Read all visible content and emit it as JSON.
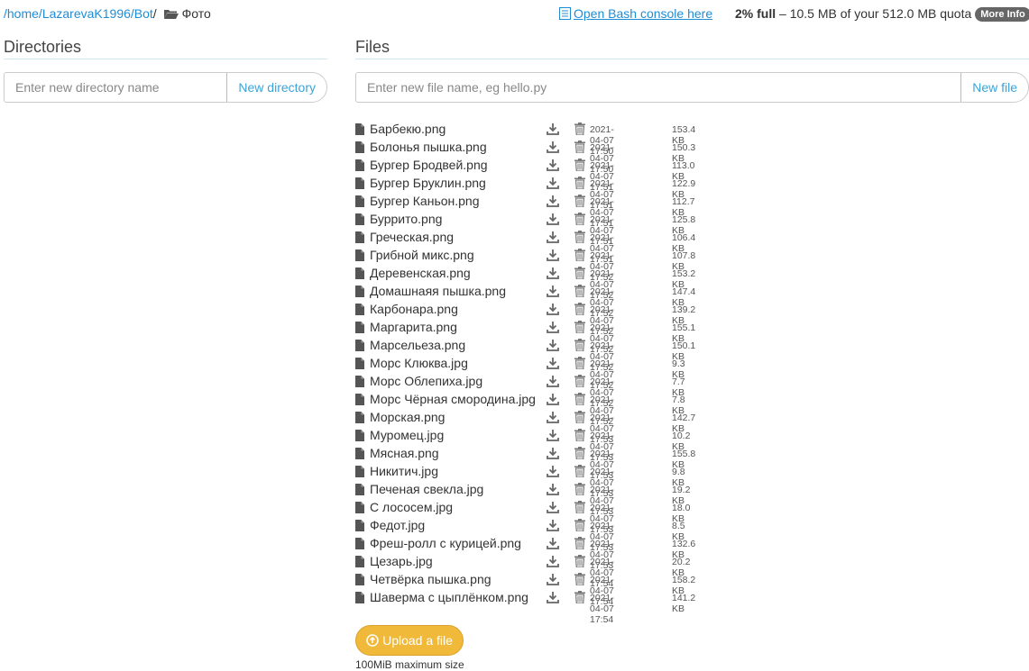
{
  "breadcrumb": {
    "segments": [
      "home",
      "LazarevaK1996",
      "Bot"
    ],
    "current": "Фото"
  },
  "header": {
    "bash_link": "Open Bash console here",
    "quota_percent": "2% full",
    "quota_text": " – 10.5 MB of your 512.0 MB quota",
    "more_info": "More Info"
  },
  "directories": {
    "title": "Directories",
    "placeholder": "Enter new directory name",
    "button": "New directory"
  },
  "files": {
    "title": "Files",
    "placeholder": "Enter new file name, eg hello.py",
    "button": "New file",
    "items": [
      {
        "name": "Барбекю.png",
        "date": "2021-04-07 17:50",
        "size": "153.4 KB"
      },
      {
        "name": "Болонья пышка.png",
        "date": "2021-04-07 17:50",
        "size": "150.3 KB"
      },
      {
        "name": "Бургер Бродвей.png",
        "date": "2021-04-07 17:51",
        "size": "113.0 KB"
      },
      {
        "name": "Бургер Бруклин.png",
        "date": "2021-04-07 17:51",
        "size": "122.9 KB"
      },
      {
        "name": "Бургер Каньон.png",
        "date": "2021-04-07 17:51",
        "size": "112.7 KB"
      },
      {
        "name": "Буррито.png",
        "date": "2021-04-07 17:51",
        "size": "125.8 KB"
      },
      {
        "name": "Греческая.png",
        "date": "2021-04-07 17:51",
        "size": "106.4 KB"
      },
      {
        "name": "Грибной микс.png",
        "date": "2021-04-07 17:52",
        "size": "107.8 KB"
      },
      {
        "name": "Деревенская.png",
        "date": "2021-04-07 17:52",
        "size": "153.2 KB"
      },
      {
        "name": "Домашнаяя пышка.png",
        "date": "2021-04-07 17:52",
        "size": "147.4 KB"
      },
      {
        "name": "Карбонара.png",
        "date": "2021-04-07 17:52",
        "size": "139.2 KB"
      },
      {
        "name": "Маргарита.png",
        "date": "2021-04-07 17:52",
        "size": "155.1 KB"
      },
      {
        "name": "Марсельеза.png",
        "date": "2021-04-07 17:52",
        "size": "150.1 KB"
      },
      {
        "name": "Морс Клюква.jpg",
        "date": "2021-04-07 17:52",
        "size": "9.3 KB"
      },
      {
        "name": "Морс Облепиха.jpg",
        "date": "2021-04-07 17:52",
        "size": "7.7 KB"
      },
      {
        "name": "Морс Чёрная смородина.jpg",
        "date": "2021-04-07 17:52",
        "size": "7.8 KB"
      },
      {
        "name": "Морская.png",
        "date": "2021-04-07 17:53",
        "size": "142.7 KB"
      },
      {
        "name": "Муромец.jpg",
        "date": "2021-04-07 17:53",
        "size": "10.2 KB"
      },
      {
        "name": "Мясная.png",
        "date": "2021-04-07 17:53",
        "size": "155.8 KB"
      },
      {
        "name": "Никитич.jpg",
        "date": "2021-04-07 17:53",
        "size": "9.8 KB"
      },
      {
        "name": "Печеная свекла.jpg",
        "date": "2021-04-07 17:53",
        "size": "19.2 KB"
      },
      {
        "name": "С лососем.jpg",
        "date": "2021-04-07 17:53",
        "size": "18.0 KB"
      },
      {
        "name": "Федот.jpg",
        "date": "2021-04-07 17:53",
        "size": "8.5 KB"
      },
      {
        "name": "Фреш-ролл с курицей.png",
        "date": "2021-04-07 17:53",
        "size": "132.6 KB"
      },
      {
        "name": "Цезарь.jpg",
        "date": "2021-04-07 17:54",
        "size": "20.2 KB"
      },
      {
        "name": "Четвёрка пышка.png",
        "date": "2021-04-07 17:54",
        "size": "158.2 KB"
      },
      {
        "name": "Шаверма с цыплёнком.png",
        "date": "2021-04-07 17:54",
        "size": "141.2 KB"
      }
    ]
  },
  "upload": {
    "button": "Upload a file",
    "note": "100MiB maximum size"
  },
  "colors": {
    "link": "#1f8dd6",
    "upload": "#f0b93a",
    "rule": "#cfe7f3"
  }
}
